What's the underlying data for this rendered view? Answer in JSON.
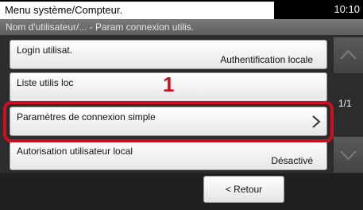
{
  "header": {
    "title": "Menu système/Compteur.",
    "time": "10:10"
  },
  "subheader": {
    "breadcrumb": "Nom d'utilisateur/... - Param connexion utilis."
  },
  "list": {
    "items": [
      {
        "label": "Login utilisat.",
        "value": "Authentification locale"
      },
      {
        "label": "Liste utilis loc",
        "value": ""
      },
      {
        "label": "Paramètres de connexion simple",
        "value": "",
        "has_arrow": true
      },
      {
        "label": "Autorisation utilisateur local",
        "value": "Désactivé"
      }
    ]
  },
  "callout": {
    "number": "1"
  },
  "pagination": {
    "indicator": "1/1"
  },
  "footer": {
    "back_label": "< Retour"
  },
  "colors": {
    "highlight": "#cc1020",
    "background": "#2b2b2b"
  },
  "icons": {
    "scroll_up": "chevron-up-icon",
    "scroll_down": "chevron-down-icon",
    "item_arrow": "chevron-right-icon"
  }
}
